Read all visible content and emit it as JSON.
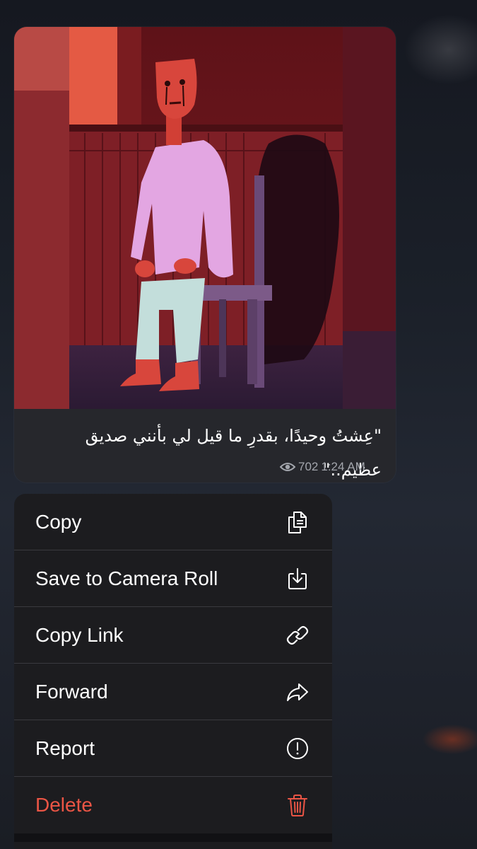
{
  "message": {
    "caption": "\"عِشتُ وحيدًا، بقدرِ ما قيل لي بأنني صديق عظيم..\"",
    "views": "702",
    "time": "1:24 AM"
  },
  "menu": {
    "items": [
      {
        "label": "Copy",
        "icon": "copy-icon"
      },
      {
        "label": "Save to Camera Roll",
        "icon": "save-download-icon"
      },
      {
        "label": "Copy Link",
        "icon": "link-icon"
      },
      {
        "label": "Forward",
        "icon": "forward-arrow-icon"
      },
      {
        "label": "Report",
        "icon": "exclamation-circle-icon"
      },
      {
        "label": "Delete",
        "icon": "trash-icon"
      }
    ]
  },
  "colors": {
    "destructive": "#eb5545",
    "menu_background": "#1c1c1f",
    "bubble_background": "#26272c"
  }
}
